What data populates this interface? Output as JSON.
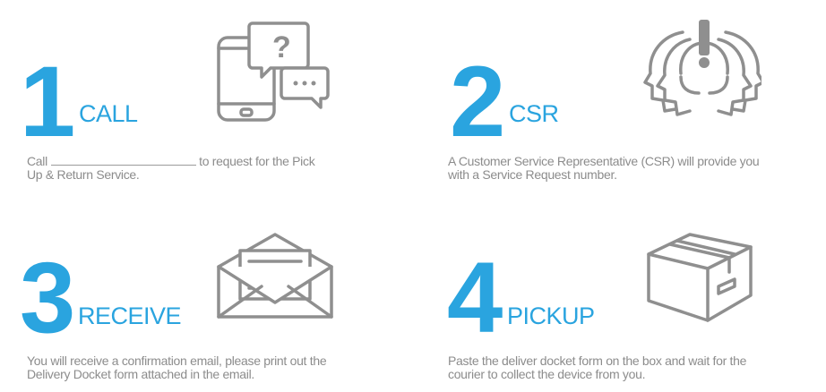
{
  "steps": [
    {
      "number": "1",
      "label": "CALL",
      "icon": "phone-chat-icon",
      "desc_before": "Call",
      "desc_after": "to request for the Pick",
      "desc_line2": "Up & Return Service."
    },
    {
      "number": "2",
      "label": "CSR",
      "icon": "headset-agent-icon",
      "desc_line1": "A Customer Service Representative (CSR) will provide you",
      "desc_line2": "with a Service Request number."
    },
    {
      "number": "3",
      "label": "RECEIVE",
      "icon": "envelope-letter-icon",
      "desc_line1": "You will receive a confirmation email, please print out the",
      "desc_line2": "Delivery Docket form attached in the email."
    },
    {
      "number": "4",
      "label": "PICKUP",
      "icon": "box-icon",
      "desc_line1": "Paste the deliver docket form on the box and wait for the",
      "desc_line2": "courier to collect the device from you."
    }
  ],
  "colors": {
    "accent": "#2aa4df",
    "text": "#8c8c8c",
    "icon_stroke": "#8f8f8f"
  }
}
